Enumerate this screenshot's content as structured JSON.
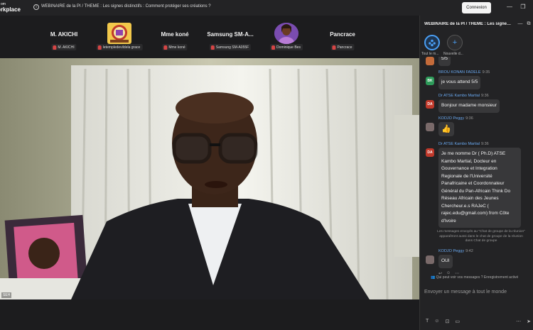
{
  "app": {
    "logo_line1": "om",
    "logo_line2": "orkplace",
    "meeting_title": "WEBINAIRE de la PI / THEME : Les signes distinctifs : Comment protéger ses créations ?",
    "login_label": "Connexion"
  },
  "participants": [
    {
      "name": "M. AKICHI",
      "tag": "M. AKICHI",
      "avatar": ""
    },
    {
      "name": "",
      "tag": "letempledevildela grace",
      "avatar": "logo"
    },
    {
      "name": "Mme koné",
      "tag": "Mme koné",
      "avatar": ""
    },
    {
      "name": "Samsung  SM-A...",
      "tag": "Samsung SM-A055F",
      "avatar": ""
    },
    {
      "name": "",
      "tag": "Dominique Bes",
      "avatar": "photo"
    },
    {
      "name": "Pancrace",
      "tag": "Pancrace",
      "avatar": ""
    }
  ],
  "video": {
    "label": "SEH"
  },
  "chat": {
    "title": "WEBINAIRE de la PI / THEME : Les signes distinctifs",
    "tabs": [
      {
        "label": "Tout le m..."
      },
      {
        "label": "Nouvelle d..."
      }
    ],
    "messages": [
      {
        "sender": "",
        "time": "",
        "initials": "",
        "text": "5/5"
      },
      {
        "sender": "BROU KONAN FADELE",
        "time": "9:35",
        "initials": "BK",
        "text": "je vous attend 5/5"
      },
      {
        "sender": "Dr ATSE Kambo Martial",
        "time": "9:36",
        "initials": "DA",
        "text": "Bonjour madame monsieur"
      },
      {
        "sender": "KODJO Peggy",
        "time": "9:36",
        "initials": "",
        "text": "👍"
      },
      {
        "sender": "Dr ATSE Kambo Martial",
        "time": "9:36",
        "initials": "DA",
        "text": "Je me nomme Dr ( Ph.D) ATSE Kambo Martial,  Docteur en Gouvernance et Integration Regionale de l'Université Panafricaine et Coordonnateur Général du Pan-Africain Think Do Réseau Africain des Jeunes Chercheur.e.s RAJeC ( rajec.edu@gmail.com) from Côte d'Ivoire"
      },
      {
        "sender": "KODJO Peggy",
        "time": "9:42",
        "initials": "",
        "text": "OUI"
      }
    ],
    "system_note": "Les messages envoyés au \"Chat de groupe de la réunion\" apparaîtront aussi dans le chat de groupe de la réunion dans Chat de groupe",
    "who_sees": "Qui peut voir vos messages ? Enregistrement activé",
    "composer_placeholder": "Envoyer un message à tout le monde"
  },
  "colors": {
    "accent": "#4a9ff5",
    "mic_off": "#d64545",
    "avatar_bk": "#2e9b5a",
    "avatar_da": "#c0392b"
  }
}
